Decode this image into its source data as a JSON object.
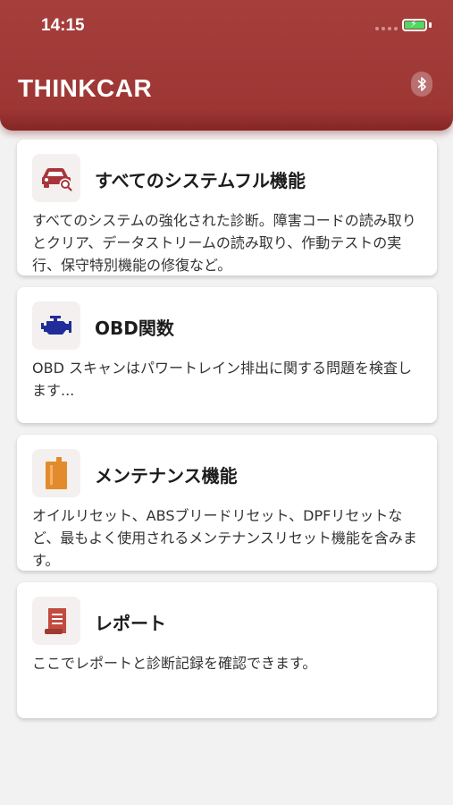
{
  "status_bar": {
    "time": "14:15"
  },
  "header": {
    "brand": "THINKCAR"
  },
  "colors": {
    "header": "#a63f3c",
    "accent_red": "#a8353a",
    "engine_blue": "#1f2c9a",
    "maint_orange": "#e38b2c",
    "report_red": "#c24a3e"
  },
  "cards": [
    {
      "icon": "car-search-icon",
      "title": "すべてのシステムフル機能",
      "description": "すべてのシステムの強化された診断。障害コードの読み取りとクリア、データストリームの読み取り、作動テストの実行、保守特別機能の修復など。"
    },
    {
      "icon": "engine-icon",
      "title": "OBD関数",
      "description": "OBD スキャンはパワートレイン排出に関する問題を検査します..."
    },
    {
      "icon": "oil-can-icon",
      "title": "メンテナンス機能",
      "description": "オイルリセット、ABSブリードリセット、DPFリセットなど、最もよく使用されるメンテナンスリセット機能を含みます。"
    },
    {
      "icon": "report-icon",
      "title": "レポート",
      "description": "ここでレポートと診断記録を確認できます。"
    }
  ]
}
